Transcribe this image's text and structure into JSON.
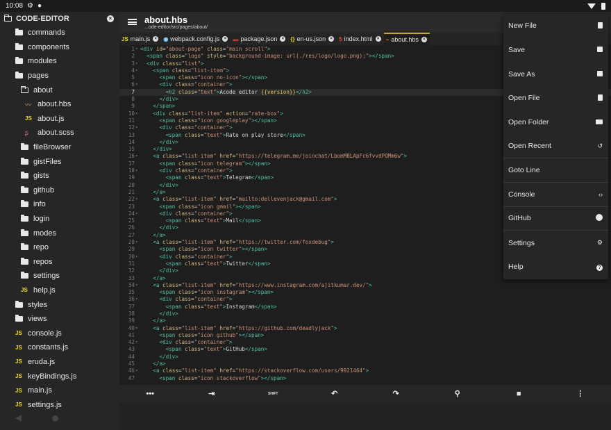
{
  "status": {
    "time": "10:08"
  },
  "sidebar": {
    "title": "CODE-EDITOR",
    "items": [
      {
        "label": "commands",
        "kind": "folder",
        "indent": 0
      },
      {
        "label": "components",
        "kind": "folder",
        "indent": 0
      },
      {
        "label": "modules",
        "kind": "folder",
        "indent": 0
      },
      {
        "label": "pages",
        "kind": "folder",
        "indent": 0
      },
      {
        "label": "about",
        "kind": "folder-open",
        "indent": 1
      },
      {
        "label": "about.hbs",
        "kind": "hbs",
        "indent": 2
      },
      {
        "label": "about.js",
        "kind": "js",
        "indent": 2
      },
      {
        "label": "about.scss",
        "kind": "scss",
        "indent": 2
      },
      {
        "label": "fileBrowser",
        "kind": "folder",
        "indent": 1
      },
      {
        "label": "gistFiles",
        "kind": "folder",
        "indent": 1
      },
      {
        "label": "gists",
        "kind": "folder",
        "indent": 1
      },
      {
        "label": "github",
        "kind": "folder",
        "indent": 1
      },
      {
        "label": "info",
        "kind": "folder",
        "indent": 1
      },
      {
        "label": "login",
        "kind": "folder",
        "indent": 1
      },
      {
        "label": "modes",
        "kind": "folder",
        "indent": 1
      },
      {
        "label": "repo",
        "kind": "folder",
        "indent": 1
      },
      {
        "label": "repos",
        "kind": "folder",
        "indent": 1
      },
      {
        "label": "settings",
        "kind": "folder",
        "indent": 1
      },
      {
        "label": "help.js",
        "kind": "js",
        "indent": 1
      },
      {
        "label": "styles",
        "kind": "folder",
        "indent": 0
      },
      {
        "label": "views",
        "kind": "folder",
        "indent": 0
      },
      {
        "label": "console.js",
        "kind": "js",
        "indent": 0
      },
      {
        "label": "constants.js",
        "kind": "js",
        "indent": 0
      },
      {
        "label": "eruda.js",
        "kind": "js",
        "indent": 0
      },
      {
        "label": "keyBindings.js",
        "kind": "js",
        "indent": 0
      },
      {
        "label": "main.js",
        "kind": "js",
        "indent": 0
      },
      {
        "label": "settings.js",
        "kind": "js",
        "indent": 0
      }
    ]
  },
  "header": {
    "title": "about.hbs",
    "path": "...ode-editor/src/pages/about/"
  },
  "tabs": [
    {
      "label": "main.js",
      "icon": "JS",
      "color": "#f5de19",
      "active": false
    },
    {
      "label": "webpack.config.js",
      "icon": "◉",
      "color": "#8ed6fb",
      "active": false
    },
    {
      "label": "package.json",
      "icon": "▬",
      "color": "#cb3837",
      "active": false
    },
    {
      "label": "en-us.json",
      "icon": "{}",
      "color": "#f5de19",
      "active": false
    },
    {
      "label": "index.html",
      "icon": "5",
      "color": "#e44d26",
      "active": false
    },
    {
      "label": "about.hbs",
      "icon": "~",
      "color": "#e3a55b",
      "active": true
    }
  ],
  "code_lines": [
    "<div id=\"about-page\" class=\"main scroll\">",
    "  <span class=\"logo\" style=\"background-image: url(./res/logo/logo.png);\"></span>",
    "  <div class=\"list\">",
    "    <span class=\"list-item\">",
    "      <span class=\"icon no-icon\"></span>",
    "      <div class=\"container\">",
    "        <h2 class=\"text\">Acode editor {{version}}</h2>",
    "      </div>",
    "    </span>",
    "    <div class=\"list-item\" action=\"rate-box\">",
    "      <span class=\"icon googleplay\"></span>",
    "      <div class=\"container\">",
    "        <span class=\"text\">Rate on play store</span>",
    "      </div>",
    "    </div>",
    "    <a class=\"list-item\" href=\"https://telegram.me/joinchat/LbomMBLApFc6fvvdPQMm6w\">",
    "      <span class=\"icon telegram\"></span>",
    "      <div class=\"container\">",
    "        <span class=\"text\">Telegram</span>",
    "      </div>",
    "    </a>",
    "    <a class=\"list-item\" href=\"mailto:dellevenjack@gmail.com\">",
    "      <span class=\"icon gmail\"></span>",
    "      <div class=\"container\">",
    "        <span class=\"text\">Mail</span>",
    "      </div>",
    "    </a>",
    "    <a class=\"list-item\" href=\"https://twitter.com/foxdebug\">",
    "      <span class=\"icon twitter\"></span>",
    "      <div class=\"container\">",
    "        <span class=\"text\">Twitter</span>",
    "      </div>",
    "    </a>",
    "    <a class=\"list-item\" href=\"https://www.instagram.com/ajitkumar.dev/\">",
    "      <span class=\"icon instagram\"></span>",
    "      <div class=\"container\">",
    "        <span class=\"text\">Instagram</span>",
    "      </div>",
    "    </a>",
    "    <a class=\"list-item\" href=\"https://github.com/deadlyjack\">",
    "      <span class=\"icon github\"></span>",
    "      <div class=\"container\">",
    "        <span class=\"text\">GitHub</span>",
    "      </div>",
    "    </a>",
    "    <a class=\"list-item\" href=\"https://stackoverflow.com/users/9921464\">",
    "      <span class=\"icon stackoverflow\"></span>"
  ],
  "fold_lines": [
    1,
    3,
    4,
    6,
    10,
    12,
    16,
    18,
    22,
    24,
    28,
    30,
    34,
    36,
    40,
    42,
    46
  ],
  "highlight_line": 7,
  "toolbar": {
    "items": [
      {
        "name": "more-horiz-icon",
        "glyph": "•••"
      },
      {
        "name": "tab-key-icon",
        "glyph": "⇥"
      },
      {
        "name": "shift-key-icon",
        "glyph": "SHIFT"
      },
      {
        "name": "undo-icon",
        "glyph": "↶"
      },
      {
        "name": "redo-icon",
        "glyph": "↷"
      },
      {
        "name": "search-icon",
        "glyph": "⚲"
      },
      {
        "name": "save-icon",
        "glyph": "■"
      },
      {
        "name": "more-vert-icon",
        "glyph": "⋮"
      }
    ]
  },
  "menu": {
    "items": [
      {
        "label": "New File",
        "icon": "new-file-icon",
        "sep": false
      },
      {
        "label": "Save",
        "icon": "save-icon",
        "sep": false
      },
      {
        "label": "Save As",
        "icon": "save-as-icon",
        "sep": false
      },
      {
        "label": "Open File",
        "icon": "open-file-icon",
        "sep": false
      },
      {
        "label": "Open Folder",
        "icon": "folder-icon",
        "sep": false
      },
      {
        "label": "Open Recent",
        "icon": "history-icon",
        "sep": true
      },
      {
        "label": "Goto Line",
        "icon": "",
        "sep": true
      },
      {
        "label": "Console",
        "icon": "code-icon",
        "sep": true
      },
      {
        "label": "GitHub",
        "icon": "github-icon",
        "sep": true
      },
      {
        "label": "Settings",
        "icon": "gear-icon",
        "sep": false
      },
      {
        "label": "Help",
        "icon": "help-icon",
        "sep": false
      }
    ]
  }
}
